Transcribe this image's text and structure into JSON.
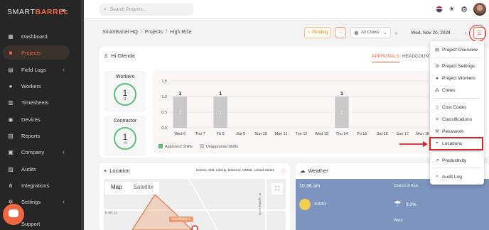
{
  "brand": {
    "prefix": "SMART",
    "suffix": "BARREL"
  },
  "colors": {
    "accent": "#f0663f",
    "sidebar_bg": "#262626",
    "approved": "#5cbf78",
    "bar": "#c9c9c9",
    "highlight": "#d9232a"
  },
  "sidebar": {
    "items": [
      {
        "label": "Dashboard",
        "icon": "dashboard-icon"
      },
      {
        "label": "Projects",
        "icon": "briefcase-icon"
      },
      {
        "label": "Field Logs",
        "icon": "book-icon"
      },
      {
        "label": "Workers",
        "icon": "user-icon"
      },
      {
        "label": "Timesheets",
        "icon": "timesheet-icon"
      },
      {
        "label": "Devices",
        "icon": "device-icon"
      },
      {
        "label": "Reports",
        "icon": "report-icon"
      },
      {
        "label": "Company",
        "icon": "building-icon"
      },
      {
        "label": "Audits",
        "icon": "audit-icon"
      },
      {
        "label": "Integrations",
        "icon": "integration-icon"
      },
      {
        "label": "Settings",
        "icon": "gear-icon"
      },
      {
        "label": "Support",
        "icon": "support-icon"
      }
    ]
  },
  "search": {
    "placeholder": "Search Projects..."
  },
  "breadcrumb": {
    "items": [
      "SmartBarrel HQ",
      "Projects",
      "High Rise"
    ]
  },
  "toolbar": {
    "pending_label": "Pending",
    "crews_label": "All Crews",
    "date": "Wed, Nov 20, 2024"
  },
  "greeting": "Hi Glenda",
  "tabs": [
    "APPROVALS",
    "HEADCOUNTS"
  ],
  "stats": [
    {
      "label": "Workers",
      "value": "1",
      "total": "/1"
    },
    {
      "label": "Contractor",
      "value": "1",
      "total": "/4"
    }
  ],
  "chart_data": {
    "type": "bar",
    "categories": [
      "Wed 6",
      "Thu 7",
      "Fri 8",
      "Sat 9",
      "Sun 10",
      "Mon 11",
      "Tue 12",
      "Wed 13",
      "Thu 14",
      "Fri 15",
      "Sat 16",
      "Sun 17",
      "Mon 18"
    ],
    "series": [
      {
        "name": "Approved Shifts",
        "values": [
          0,
          0,
          0,
          0,
          0,
          0,
          0,
          0,
          0,
          0,
          0,
          0,
          0
        ]
      },
      {
        "name": "Unapproved Shifts",
        "values": [
          1,
          0,
          1,
          0,
          0,
          0,
          0,
          0,
          1,
          0,
          0,
          0,
          0
        ]
      }
    ],
    "top_labels": [
      "1",
      "",
      "1",
      "",
      "",
      "",
      "",
      "",
      "1",
      "",
      "",
      "",
      ""
    ],
    "inner_labels": [
      "1",
      "",
      "1",
      "",
      "",
      "",
      "",
      "",
      "1",
      "",
      "",
      "",
      ""
    ],
    "yticks": [
      "1.5",
      "1.0",
      "0.5",
      "0.0"
    ],
    "ylim": [
      0,
      1.5
    ]
  },
  "location": {
    "title": "Location",
    "address": "Haines, 800, Liberty, Missouri, 64068, United States",
    "map_label": "Map",
    "satellite_label": "Satellite",
    "geofence": "Geofence 1",
    "streets": [
      "E 9th St",
      "N Lightburne St"
    ]
  },
  "weather": {
    "title": "Weather",
    "time": "10:36 am",
    "condition": "SUNNY",
    "rain_label": "Chance of Rain",
    "rain_value": "0.0%",
    "wind_label": "Wind"
  },
  "menu": {
    "items": [
      {
        "label": "Project Overview",
        "icon": "overview-icon"
      },
      {
        "label": "Project Settings",
        "icon": "gear-icon"
      },
      {
        "label": "Project Workers",
        "icon": "user-icon"
      },
      {
        "label": "Crews",
        "icon": "crew-icon"
      },
      {
        "label": "Cost Codes",
        "icon": "document-icon"
      },
      {
        "label": "Classifications",
        "icon": "list-icon"
      },
      {
        "label": "Piecework",
        "icon": "hammer-icon"
      },
      {
        "label": "Locations",
        "icon": "map-pin-icon"
      },
      {
        "label": "Productivity",
        "icon": "chart-icon"
      },
      {
        "label": "Audit Log",
        "icon": "search-icon"
      }
    ]
  }
}
